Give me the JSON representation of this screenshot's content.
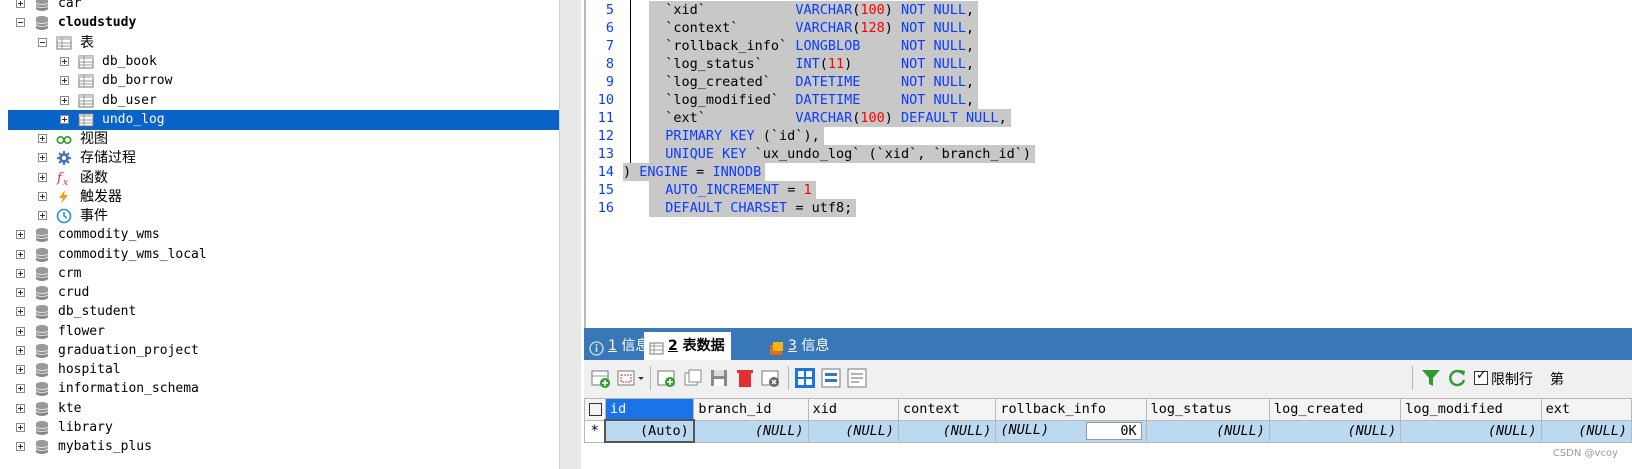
{
  "tree": {
    "items": [
      {
        "label": "car",
        "level": 0,
        "type": "db",
        "expanded": false
      },
      {
        "label": "cloudstudy",
        "level": 0,
        "type": "db",
        "expanded": true,
        "bold": true
      },
      {
        "label": "表",
        "level": 1,
        "type": "tables",
        "expanded": true
      },
      {
        "label": "db_book",
        "level": 2,
        "type": "table",
        "expanded": false
      },
      {
        "label": "db_borrow",
        "level": 2,
        "type": "table",
        "expanded": false
      },
      {
        "label": "db_user",
        "level": 2,
        "type": "table",
        "expanded": false
      },
      {
        "label": "undo_log",
        "level": 2,
        "type": "table",
        "expanded": false,
        "selected": true
      },
      {
        "label": "视图",
        "level": 1,
        "type": "views",
        "expanded": false
      },
      {
        "label": "存储过程",
        "level": 1,
        "type": "procs",
        "expanded": false
      },
      {
        "label": "函数",
        "level": 1,
        "type": "funcs",
        "expanded": false
      },
      {
        "label": "触发器",
        "level": 1,
        "type": "triggers",
        "expanded": false
      },
      {
        "label": "事件",
        "level": 1,
        "type": "events",
        "expanded": false
      },
      {
        "label": "commodity_wms",
        "level": 0,
        "type": "db",
        "expanded": false
      },
      {
        "label": "commodity_wms_local",
        "level": 0,
        "type": "db",
        "expanded": false
      },
      {
        "label": "crm",
        "level": 0,
        "type": "db",
        "expanded": false
      },
      {
        "label": "crud",
        "level": 0,
        "type": "db",
        "expanded": false
      },
      {
        "label": "db_student",
        "level": 0,
        "type": "db",
        "expanded": false
      },
      {
        "label": "flower",
        "level": 0,
        "type": "db",
        "expanded": false
      },
      {
        "label": "graduation_project",
        "level": 0,
        "type": "db",
        "expanded": false
      },
      {
        "label": "hospital",
        "level": 0,
        "type": "db",
        "expanded": false
      },
      {
        "label": "information_schema",
        "level": 0,
        "type": "db",
        "expanded": false
      },
      {
        "label": "kte",
        "level": 0,
        "type": "db",
        "expanded": false
      },
      {
        "label": "library",
        "level": 0,
        "type": "db",
        "expanded": false
      },
      {
        "label": "mybatis_plus",
        "level": 0,
        "type": "db",
        "expanded": false
      }
    ]
  },
  "editor": {
    "lines": [
      {
        "n": "5",
        "html": "  `xid`           <k>VARCHAR</k>(<n>100</n>) <k>NOT NULL</k>,"
      },
      {
        "n": "6",
        "html": "  `context`       <k>VARCHAR</k>(<n>128</n>) <k>NOT NULL</k>,"
      },
      {
        "n": "7",
        "html": "  `rollback_info` <k>LONGBLOB</k>     <k>NOT NULL</k>,"
      },
      {
        "n": "8",
        "html": "  `log_status`    <k>INT</k>(<n>11</n>)      <k>NOT NULL</k>,"
      },
      {
        "n": "9",
        "html": "  `log_created`   <k>DATETIME</k>     <k>NOT NULL</k>,"
      },
      {
        "n": "10",
        "html": "  `log_modified`  <k>DATETIME</k>     <k>NOT NULL</k>,"
      },
      {
        "n": "11",
        "html": "  `ext`           <k>VARCHAR</k>(<n>100</n>) <k>DEFAULT NULL</k>,"
      },
      {
        "n": "12",
        "html": "  <k>PRIMARY KEY</k> (`id`),"
      },
      {
        "n": "13",
        "html": "  <k>UNIQUE KEY</k> `ux_undo_log` (`xid`, `branch_id`)"
      },
      {
        "n": "14",
        "html": ") <k>ENGINE</k> = <k>INNODB</k>"
      },
      {
        "n": "15",
        "html": "  <k>AUTO_INCREMENT</k> = <n>1</n>"
      },
      {
        "n": "16",
        "html": "  <k>DEFAULT CHARSET</k> = utf8;"
      }
    ]
  },
  "tabs": [
    {
      "num": "1",
      "label": "信息",
      "icon": "info-icon"
    },
    {
      "num": "2",
      "label": "表数据",
      "icon": "table-icon",
      "active": true
    },
    {
      "num": "3",
      "label": "信息",
      "icon": "table-info-icon"
    }
  ],
  "toolbar": {
    "limit_label": "限制行",
    "limit_checked": true,
    "page_label": "第"
  },
  "grid": {
    "columns": [
      "id",
      "branch_id",
      "xid",
      "context",
      "rollback_info",
      "log_status",
      "log_created",
      "log_modified",
      "ext"
    ],
    "row": {
      "marker": "*",
      "cells": [
        "(Auto)",
        "(NULL)",
        "(NULL)",
        "(NULL)",
        "(NULL)",
        "(NULL)",
        "(NULL)",
        "(NULL)",
        "(NULL)"
      ],
      "blob_size": "0K"
    }
  },
  "watermark": "CSDN @vcoy",
  "colors": {
    "selection": "#0a63c8",
    "tabbar": "#3878b8",
    "keyword": "#0a3cff",
    "number": "#ff0000",
    "code_highlight": "#c8c8c8"
  }
}
